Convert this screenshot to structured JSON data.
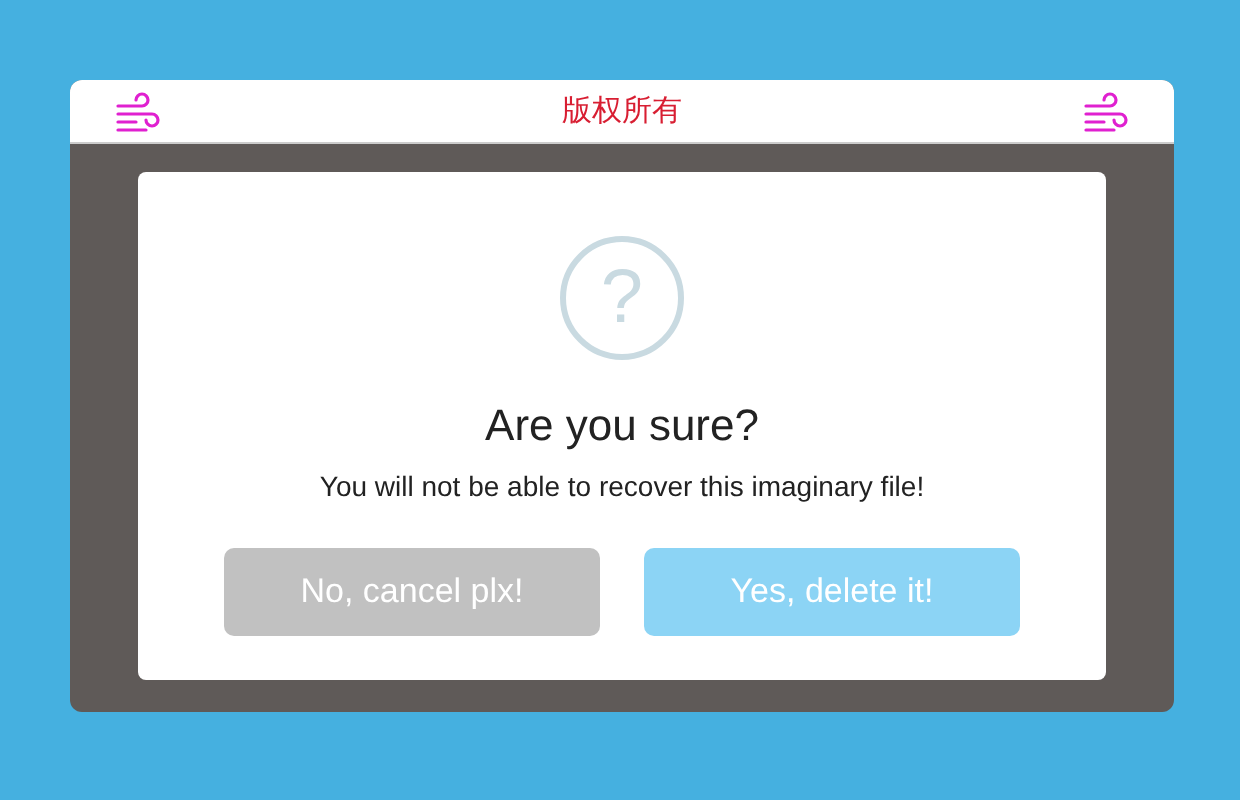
{
  "header": {
    "title": "版权所有"
  },
  "dialog": {
    "icon": "?",
    "title": "Are you sure?",
    "message": "You will not be able to recover this imaginary file!",
    "buttons": [
      {
        "label": "No, cancel plx!",
        "kind": "cancel"
      },
      {
        "label": "Yes, delete it!",
        "kind": "confirm"
      }
    ]
  }
}
